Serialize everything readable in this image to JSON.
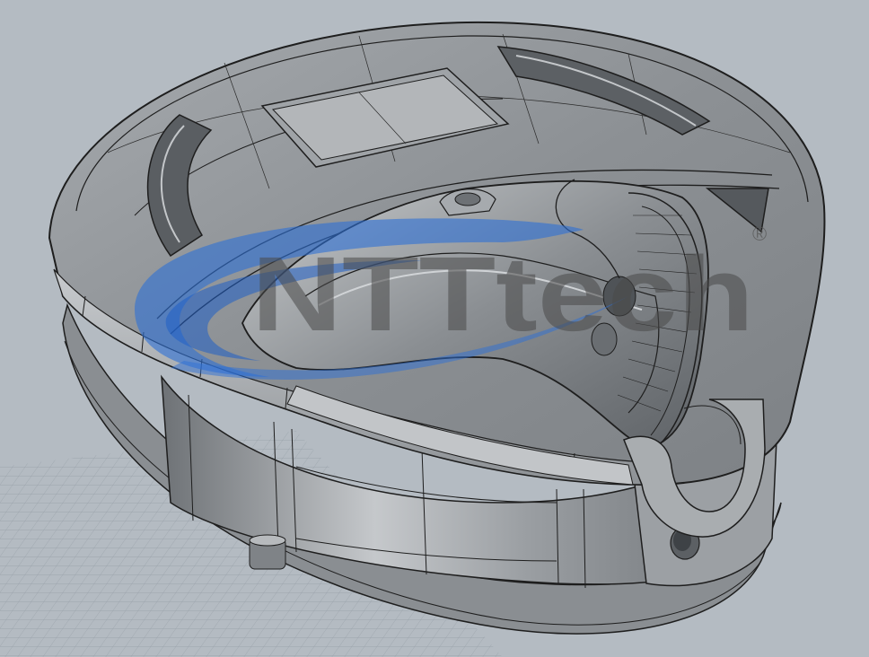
{
  "viewport": {
    "name": "perspective-viewport",
    "background_color": "#b4bbc2",
    "grid_color": "#9aa3ab",
    "model_color": "#8e9296",
    "model_highlight": "#d6d8da",
    "edge_color": "#1e1e1e"
  },
  "watermark": {
    "brand_text": "NTTtech",
    "registered_mark": "®",
    "swoosh_color": "#2d6fd6"
  }
}
